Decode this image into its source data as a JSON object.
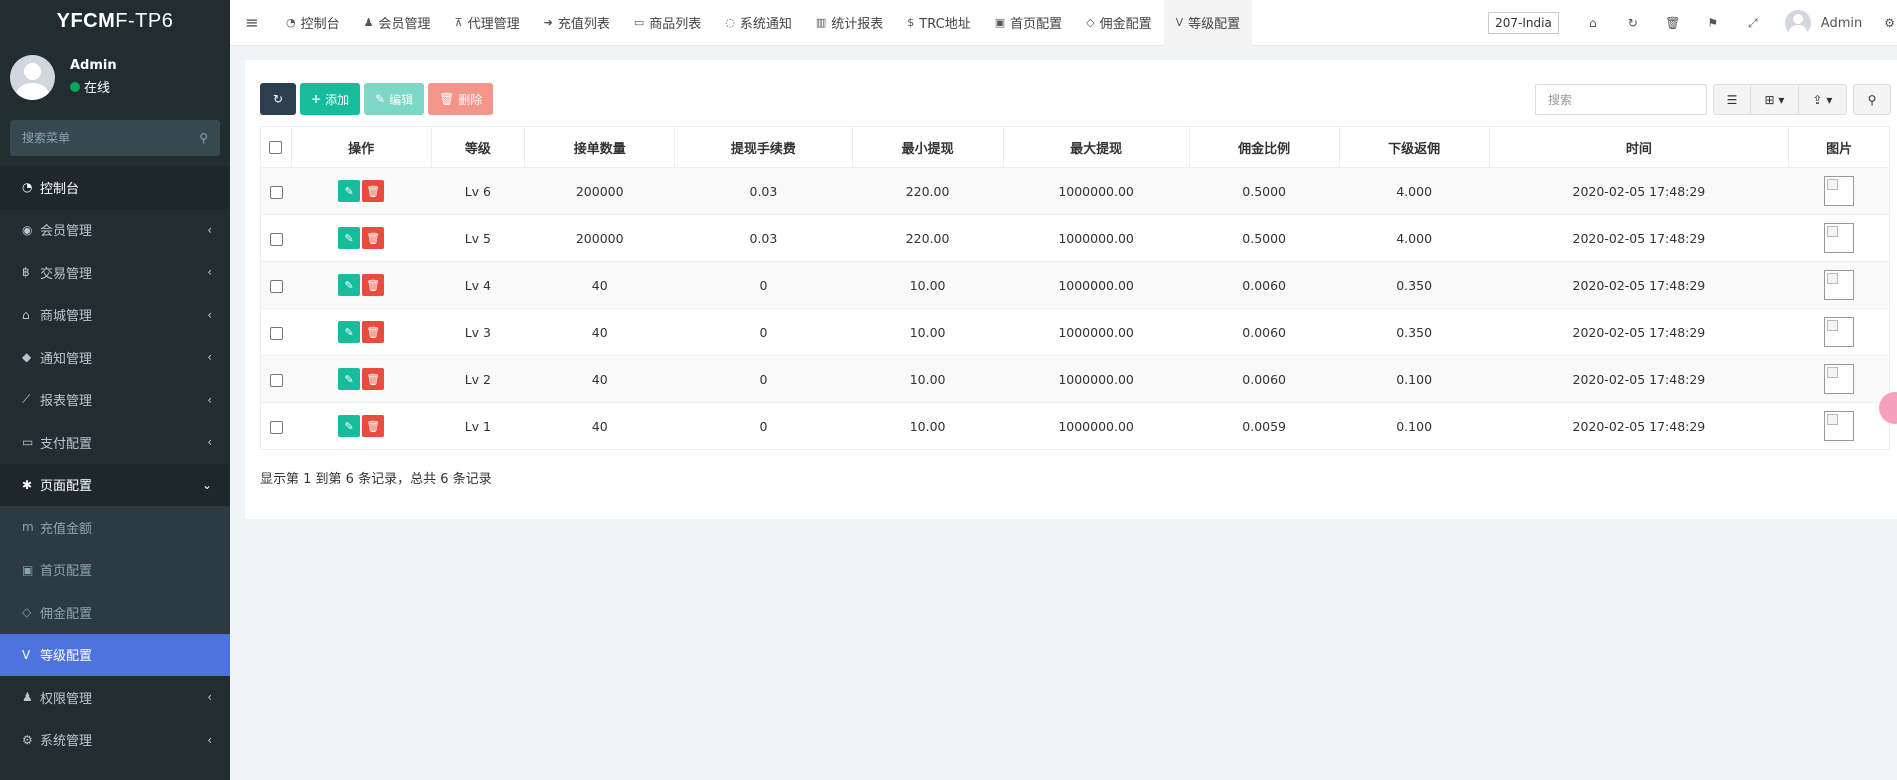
{
  "sidebar": {
    "logo": {
      "part1": "YFCM",
      "part2": "F-TP6"
    },
    "user": {
      "name": "Admin",
      "status": "在线"
    },
    "search_placeholder": "搜索菜单",
    "items": [
      {
        "label": "控制台",
        "icon": "dashboard-icon",
        "glyph": "◔",
        "state": "active-top"
      },
      {
        "label": "会员管理",
        "icon": "user-circle-icon",
        "glyph": "◉",
        "caret": "‹"
      },
      {
        "label": "交易管理",
        "icon": "bitcoin-icon",
        "glyph": "฿",
        "caret": "‹"
      },
      {
        "label": "商城管理",
        "icon": "home-icon",
        "glyph": "⌂",
        "caret": "‹"
      },
      {
        "label": "通知管理",
        "icon": "bell-icon",
        "glyph": "◆",
        "caret": "‹"
      },
      {
        "label": "报表管理",
        "icon": "line-chart-icon",
        "glyph": "⟋",
        "caret": "‹"
      },
      {
        "label": "支付配置",
        "icon": "credit-card-icon",
        "glyph": "▭",
        "caret": "‹"
      },
      {
        "label": "页面配置",
        "icon": "gear-icon",
        "glyph": "✱",
        "caret": "⌄",
        "state": "open"
      }
    ],
    "subitems": [
      {
        "label": "充值金额",
        "icon": "money-icon",
        "glyph": "m"
      },
      {
        "label": "首页配置",
        "icon": "square-icon",
        "glyph": "▣"
      },
      {
        "label": "佣金配置",
        "icon": "diamond-icon",
        "glyph": "◇"
      },
      {
        "label": "等级配置",
        "icon": "vimeo-square-icon",
        "glyph": "V",
        "state": "current"
      }
    ],
    "items_bottom": [
      {
        "label": "权限管理",
        "icon": "group-icon",
        "glyph": "♟",
        "caret": "‹"
      },
      {
        "label": "系统管理",
        "icon": "cogs-icon",
        "glyph": "⚙",
        "caret": "‹"
      }
    ]
  },
  "topbar": {
    "tabs": [
      {
        "label": "控制台",
        "icon": "dashboard-icon",
        "glyph": "◔"
      },
      {
        "label": "会员管理",
        "icon": "user-icon",
        "glyph": "♟"
      },
      {
        "label": "代理管理",
        "icon": "sitemap-icon",
        "glyph": "⊼"
      },
      {
        "label": "充值列表",
        "icon": "sign-in-icon",
        "glyph": "➜"
      },
      {
        "label": "商品列表",
        "icon": "desktop-icon",
        "glyph": "▭"
      },
      {
        "label": "系统通知",
        "icon": "comments-icon",
        "glyph": "◌"
      },
      {
        "label": "统计报表",
        "icon": "bar-chart-icon",
        "glyph": "▥"
      },
      {
        "label": "TRC地址",
        "icon": "dollar-icon",
        "glyph": "$"
      },
      {
        "label": "首页配置",
        "icon": "square-icon",
        "glyph": "▣"
      },
      {
        "label": "佣金配置",
        "icon": "diamond-icon",
        "glyph": "◇"
      },
      {
        "label": "等级配置",
        "icon": "vimeo-square-icon",
        "glyph": "V",
        "active": true
      }
    ],
    "lang": "207-India",
    "tools": [
      {
        "icon": "home-icon",
        "glyph": "⌂"
      },
      {
        "icon": "refresh-icon",
        "glyph": "↻"
      },
      {
        "icon": "trash-icon",
        "glyph": "🗑"
      },
      {
        "icon": "language-icon",
        "glyph": "⚑"
      },
      {
        "icon": "fullscreen-icon",
        "glyph": "⤢"
      }
    ],
    "admin": "Admin"
  },
  "toolbar": {
    "refresh_glyph": "↻",
    "add_label": "添加",
    "edit_label": "编辑",
    "delete_label": "删除",
    "search_placeholder": "搜索"
  },
  "table": {
    "columns": [
      "操作",
      "等级",
      "接单数量",
      "提现手续费",
      "最小提现",
      "最大提现",
      "佣金比例",
      "下级返佣",
      "时间",
      "图片"
    ],
    "rows": [
      {
        "level": "Lv 6",
        "orders": "200000",
        "fee": "0.03",
        "min": "220.00",
        "max": "1000000.00",
        "ratio": "0.5000",
        "rebate": "4.000",
        "time": "2020-02-05 17:48:29"
      },
      {
        "level": "Lv 5",
        "orders": "200000",
        "fee": "0.03",
        "min": "220.00",
        "max": "1000000.00",
        "ratio": "0.5000",
        "rebate": "4.000",
        "time": "2020-02-05 17:48:29"
      },
      {
        "level": "Lv 4",
        "orders": "40",
        "fee": "0",
        "min": "10.00",
        "max": "1000000.00",
        "ratio": "0.0060",
        "rebate": "0.350",
        "time": "2020-02-05 17:48:29"
      },
      {
        "level": "Lv 3",
        "orders": "40",
        "fee": "0",
        "min": "10.00",
        "max": "1000000.00",
        "ratio": "0.0060",
        "rebate": "0.350",
        "time": "2020-02-05 17:48:29"
      },
      {
        "level": "Lv 2",
        "orders": "40",
        "fee": "0",
        "min": "10.00",
        "max": "1000000.00",
        "ratio": "0.0060",
        "rebate": "0.100",
        "time": "2020-02-05 17:48:29"
      },
      {
        "level": "Lv 1",
        "orders": "40",
        "fee": "0",
        "min": "10.00",
        "max": "1000000.00",
        "ratio": "0.0059",
        "rebate": "0.100",
        "time": "2020-02-05 17:48:29"
      }
    ]
  },
  "pager": "显示第 1 到第 6 条记录，总共 6 条记录"
}
